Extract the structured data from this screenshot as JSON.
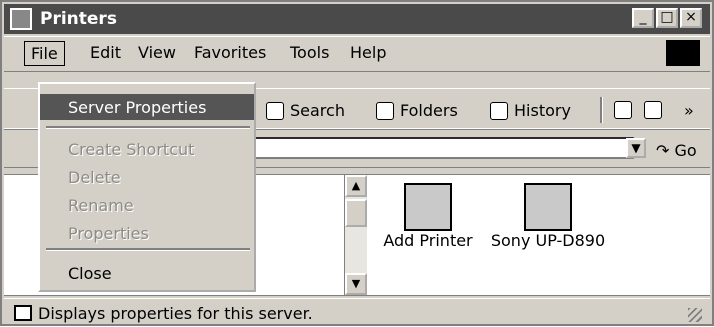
{
  "window": {
    "title": "Printers"
  },
  "title_controls": [
    "_",
    "□",
    "×"
  ],
  "menu_bar": [
    "File",
    "Edit",
    "View",
    "Favorites",
    "Tools",
    "Help"
  ],
  "toolbar": {
    "search": "Search",
    "folders": "Folders",
    "history": "History",
    "overflow": "»"
  },
  "address_bar": {
    "go": "Go"
  },
  "context_menu": {
    "server_properties": "Server Properties",
    "create_shortcut": "Create Shortcut",
    "delete": "Delete",
    "rename": "Rename",
    "properties": "Properties",
    "close": "Close"
  },
  "printers": [
    {
      "label": "Add Printer",
      "icon": "add-printer-icon"
    },
    {
      "label": "Sony UP-D890",
      "icon": "default-printer-icon"
    }
  ],
  "status_bar": {
    "text": "Displays properties for this server."
  }
}
